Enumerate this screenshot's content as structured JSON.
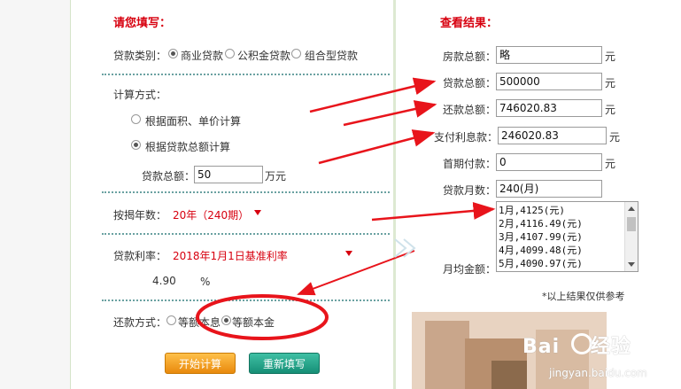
{
  "form": {
    "title": "请您填写：",
    "loan_type_label": "贷款类别：",
    "loan_types": [
      "商业贷款",
      "公积金贷款",
      "组合型贷款"
    ],
    "calc_method_label": "计算方式：",
    "calc_methods": [
      "根据面积、单价计算",
      "根据贷款总额计算"
    ],
    "loan_total_label": "贷款总额：",
    "loan_total_value": "50",
    "loan_total_unit": "万元",
    "years_label": "按揭年数：",
    "years_value": "20年（240期）",
    "rate_label": "贷款利率：",
    "rate_value": "2018年1月1日基准利率",
    "rate_input": "4.90",
    "rate_unit": "%",
    "repay_label": "还款方式：",
    "repay_options": [
      "等额本息",
      "等额本金"
    ],
    "start_button": "开始计算",
    "reset_button": "重新填写"
  },
  "results": {
    "title": "查看结果：",
    "house_total_label": "房款总额：",
    "house_total_value": "略",
    "loan_total_label": "贷款总额：",
    "loan_total_value": "500000",
    "repay_total_label": "还款总额：",
    "repay_total_value": "746020.83",
    "interest_label": "支付利息款：",
    "interest_value": "246020.83",
    "down_payment_label": "首期付款：",
    "down_payment_value": "0",
    "months_label": "贷款月数：",
    "months_value": "240(月)",
    "monthly_label": "月均金额：",
    "monthly_list": [
      "1月,4125(元)",
      "2月,4116.49(元)",
      "3月,4107.99(元)",
      "4月,4099.48(元)",
      "5月,4090.97(元)"
    ],
    "unit": "元",
    "note": "*以上结果仅供参考"
  },
  "watermark": {
    "brand": "Baidu 经验",
    "url": "jingyan.baidu.com"
  },
  "colors": {
    "accent_red": "#d7000f",
    "annotation_red": "#e8141b",
    "button_orange": "#f0a020",
    "button_teal": "#1fa389"
  }
}
